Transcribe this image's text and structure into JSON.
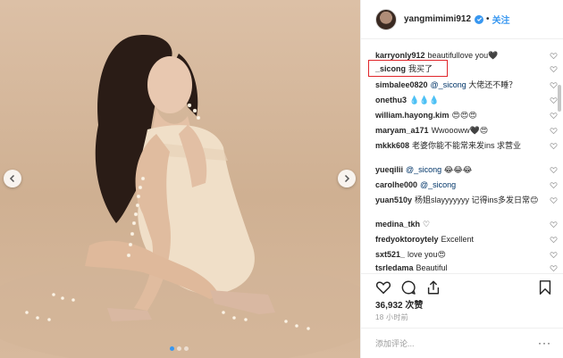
{
  "post": {
    "username": "yangmimimi912",
    "follow_label": "关注",
    "separator": "•",
    "likes": "36,932 次赞",
    "time_ago": "18 小时前",
    "comment_placeholder": "添加评论...",
    "more_label": "···"
  },
  "comments": [
    {
      "user": "karryonly912",
      "text": "beautifullove you🖤"
    },
    {
      "user": "_sicong",
      "text": "我买了"
    },
    {
      "user": "simbalee0820",
      "mention": "@_sicong",
      "text": "大佬还不睡？"
    },
    {
      "user": "onethu3",
      "text": "💧💧💧"
    },
    {
      "user": "william.hayong.kim",
      "text": "😍😍😍"
    },
    {
      "user": "maryam_a171",
      "text": "Wwoooww🖤😍"
    },
    {
      "user": "mkkk608",
      "text": "老婆你能不能常来发ins 求营业"
    },
    {
      "user": "yueqilii",
      "mention": "@_sicong",
      "text": "😂😂😂"
    },
    {
      "user": "carolhe000",
      "mention": "@_sicong",
      "text": ""
    },
    {
      "user": "yuan510y",
      "text": "杨姐slayyyyyyy 记得ins多发日常😊"
    },
    {
      "user": "medina_tkh",
      "text": "♡"
    },
    {
      "user": "fredyoktoroytely",
      "text": "Excellent"
    },
    {
      "user": "sxt521_",
      "text": "love you😍"
    },
    {
      "user": "tsrledama",
      "text": "Beautiful"
    }
  ],
  "colors": {
    "accent": "#3897f0",
    "highlight": "#e0262a",
    "background": "#dcc0a6"
  },
  "carousel": {
    "total": 3,
    "active": 1
  }
}
